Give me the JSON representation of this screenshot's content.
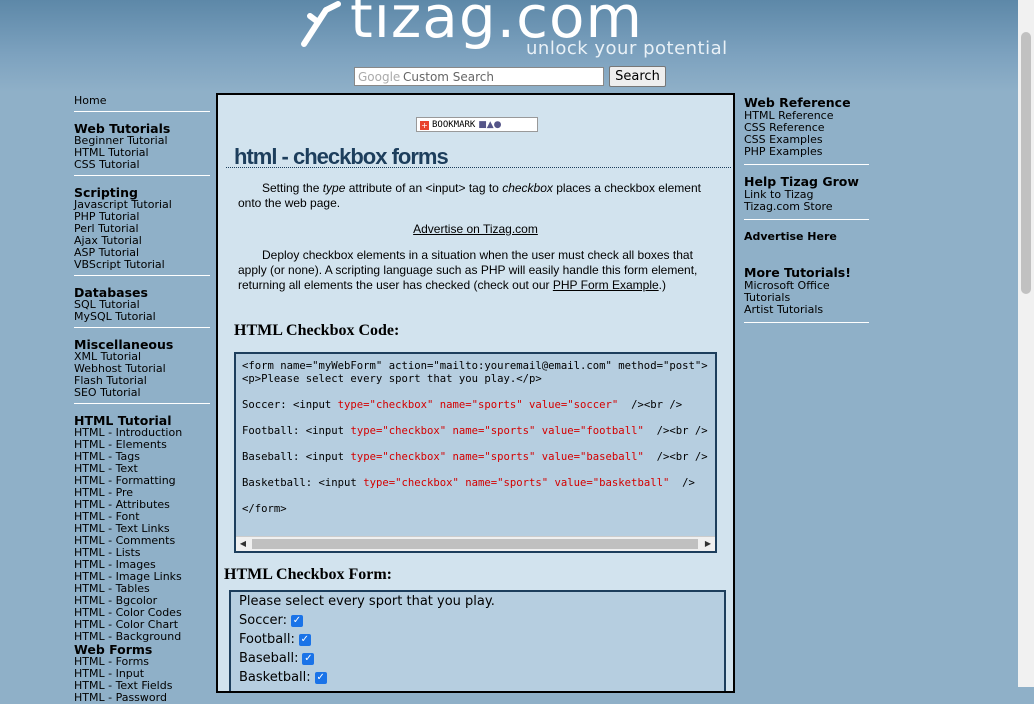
{
  "header": {
    "logo_text": "tizag.com",
    "tagline": "unlock your potential",
    "search_brand": "Google",
    "search_placeholder": "Custom Search",
    "search_button": "Search"
  },
  "left_nav": {
    "home": "Home",
    "sections": [
      {
        "heading": "Web Tutorials",
        "links": [
          "Beginner Tutorial",
          "HTML Tutorial",
          "CSS Tutorial"
        ]
      },
      {
        "heading": "Scripting",
        "links": [
          "Javascript Tutorial",
          "PHP Tutorial",
          "Perl Tutorial",
          "Ajax Tutorial",
          "ASP Tutorial",
          "VBScript Tutorial"
        ]
      },
      {
        "heading": "Databases",
        "links": [
          "SQL Tutorial",
          "MySQL Tutorial"
        ]
      },
      {
        "heading": "Miscellaneous",
        "links": [
          "XML Tutorial",
          "Webhost Tutorial",
          "Flash Tutorial",
          "SEO Tutorial"
        ]
      },
      {
        "heading": "HTML Tutorial",
        "links": [
          "HTML - Introduction",
          "HTML - Elements",
          "HTML - Tags",
          "HTML - Text",
          "HTML - Formatting",
          "HTML - Pre",
          "HTML - Attributes",
          "HTML - Font",
          "HTML - Text Links",
          "HTML - Comments",
          "HTML - Lists",
          "HTML - Images",
          "HTML - Image Links",
          "HTML - Tables",
          "HTML - Bgcolor",
          "HTML - Color Codes",
          "HTML - Color Chart",
          "HTML - Background"
        ]
      },
      {
        "heading": "Web Forms",
        "links": [
          "HTML - Forms",
          "HTML - Input",
          "HTML - Text Fields",
          "HTML - Password"
        ]
      }
    ]
  },
  "main": {
    "bookmark_label": "BOOKMARK",
    "title": "html - checkbox forms",
    "intro": {
      "p1": "Setting the ",
      "em1": "type",
      "p2": " attribute of an <input> tag to ",
      "em2": "checkbox",
      "p3": " places a checkbox element onto the web page."
    },
    "ad_link": "Advertise on Tizag.com",
    "para2": "Deploy checkbox elements in a situation when the user must check all boxes that apply (or none). A scripting language such as PHP will easily handle this form element, returning all elements the user has checked (check out our ",
    "para2_link": "PHP Form Example",
    "para2_end": ".)",
    "code_heading": "HTML Checkbox Code:",
    "code": {
      "line1": "<form name=\"myWebForm\" action=\"mailto:youremail@email.com\" method=\"post\">",
      "line2": "<p>Please select every sport that you play.</p>",
      "rows": [
        {
          "label": "Soccer: <input ",
          "attrs": "type=\"checkbox\" name=\"sports\" value=\"soccer\"",
          "end": "  /><br />"
        },
        {
          "label": "Football: <input ",
          "attrs": "type=\"checkbox\" name=\"sports\" value=\"football\"",
          "end": "  /><br />"
        },
        {
          "label": "Baseball: <input ",
          "attrs": "type=\"checkbox\" name=\"sports\" value=\"baseball\"",
          "end": "  /><br />"
        },
        {
          "label": "Basketball: <input ",
          "attrs": "type=\"checkbox\" name=\"sports\" value=\"basketball\"",
          "end": "  />"
        }
      ],
      "close": "</form>"
    },
    "form_heading": "HTML Checkbox Form:",
    "form": {
      "prompt": "Please select every sport that you play.",
      "options": [
        "Soccer:",
        "Football:",
        "Baseball:",
        "Basketball:"
      ]
    }
  },
  "right_nav": {
    "sections": [
      {
        "heading": "Web Reference",
        "links": [
          "HTML Reference",
          "CSS Reference",
          "CSS Examples",
          "PHP Examples"
        ]
      },
      {
        "heading": "Help Tizag Grow",
        "links": [
          "Link to Tizag",
          "Tizag.com Store"
        ]
      },
      {
        "heading": "Advertise Here",
        "links": []
      },
      {
        "heading": "More Tutorials!",
        "links": [
          "Microsoft Office Tutorials",
          "Artist Tutorials"
        ]
      }
    ]
  }
}
